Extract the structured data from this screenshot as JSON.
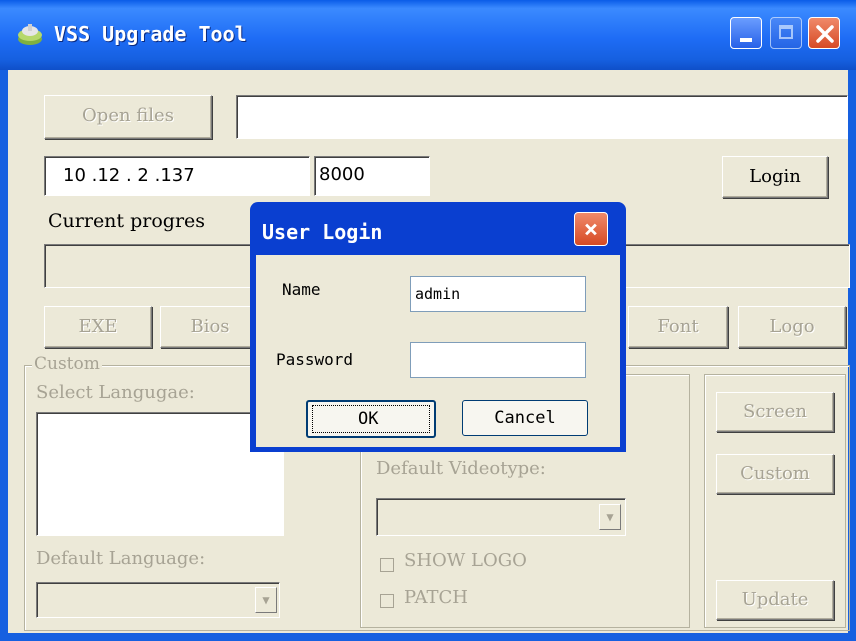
{
  "window": {
    "title": "VSS Upgrade Tool"
  },
  "toolbar": {
    "open_files_label": "Open files",
    "file_path_value": "",
    "ip_value": "10 .12 . 2 .137",
    "port_value": "8000",
    "login_label": "Login"
  },
  "progress": {
    "label": "Current progres"
  },
  "buttons": {
    "exe": "EXE",
    "bios": "Bios",
    "font": "Font",
    "logo": "Logo",
    "screen": "Screen",
    "custom": "Custom",
    "update": "Update"
  },
  "custom_group": {
    "title": "Custom",
    "select_language_label": "Select Langugae:",
    "default_language_label": "Default Language:",
    "default_videotype_label": "Default Videotype:",
    "show_logo_label": "SHOW LOGO",
    "patch_label": "PATCH"
  },
  "dialog": {
    "title": "User Login",
    "name_label": "Name",
    "name_value": "admin",
    "password_label": "Password",
    "password_value": "",
    "ok_label": "OK",
    "cancel_label": "Cancel"
  },
  "colors": {
    "titlebar": "#1660e0",
    "close": "#d64a25",
    "face": "#ece9d8"
  }
}
